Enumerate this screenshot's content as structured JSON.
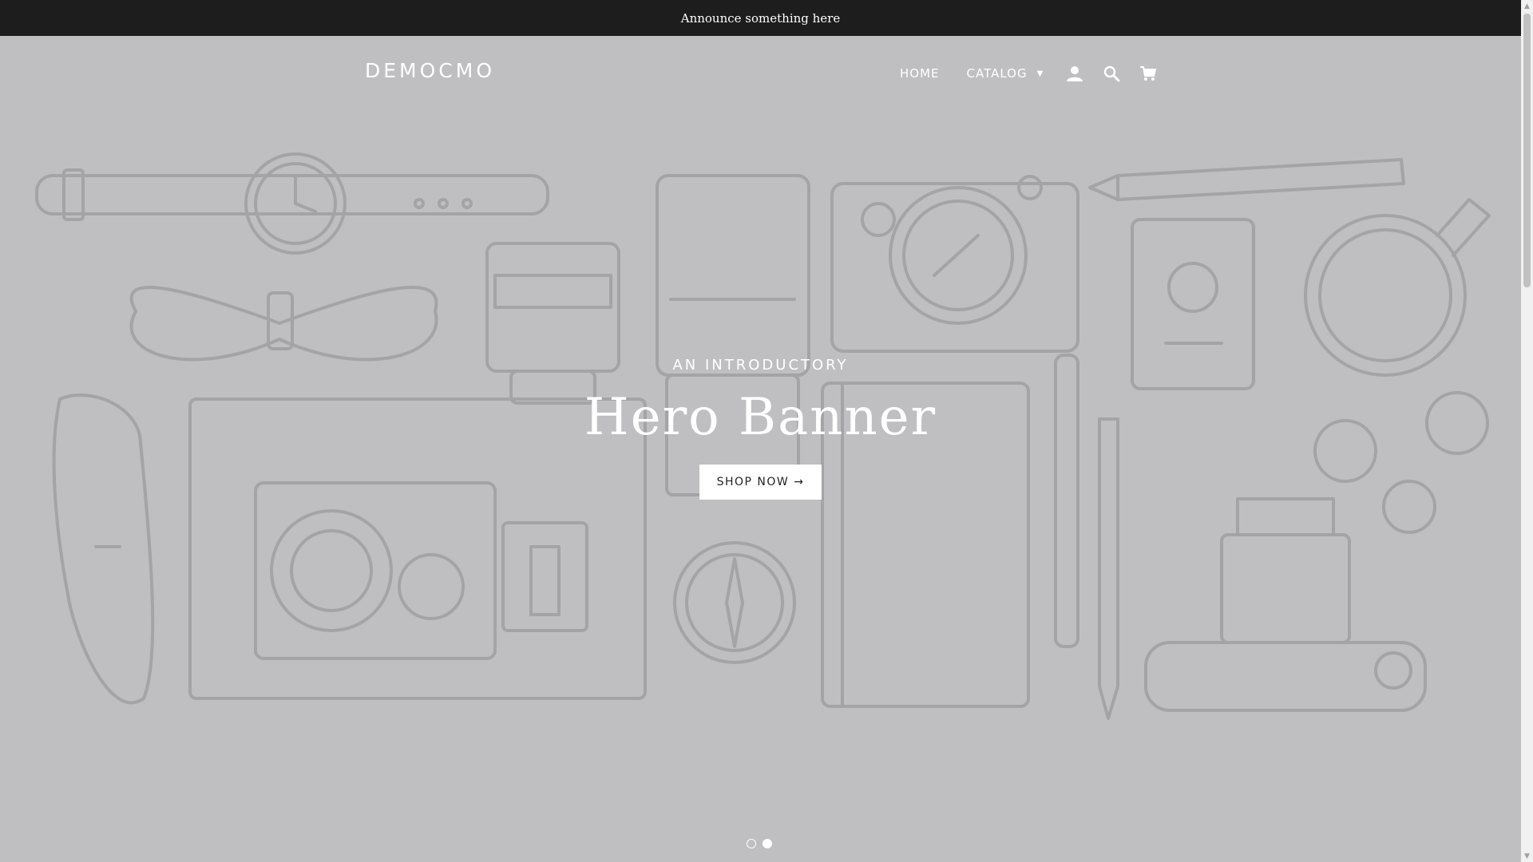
{
  "announcement": {
    "text": "Announce something here"
  },
  "header": {
    "logo": "DEMOCMO",
    "nav": {
      "home": "HOME",
      "catalog": "CATALOG",
      "caret": "▼"
    },
    "icons": [
      "account-icon",
      "search-icon",
      "cart-icon"
    ]
  },
  "hero": {
    "eyebrow": "AN INTRODUCTORY",
    "title": "Hero Banner",
    "button_label": "SHOP NOW →",
    "slides_total": 2,
    "active_slide": 2
  },
  "colors": {
    "announcement_bg": "#1d1d1d",
    "hero_bg": "#bfbfc1",
    "line_art": "#8f8f91",
    "text": "#ffffff"
  }
}
